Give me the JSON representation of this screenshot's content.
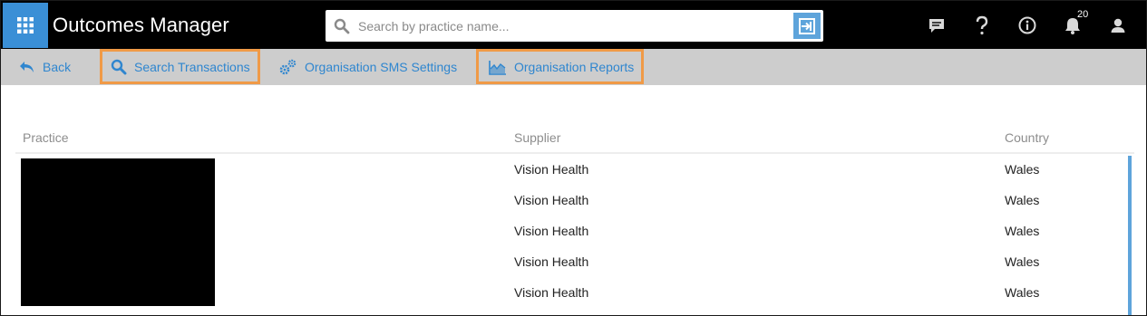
{
  "app": {
    "title": "Outcomes Manager"
  },
  "search": {
    "placeholder": "Search by practice name..."
  },
  "topbar": {
    "icons": [
      "menu-grid-icon",
      "chat-icon",
      "help-icon",
      "info-icon",
      "bell-icon",
      "user-icon"
    ],
    "notification_count": "20"
  },
  "subnav": {
    "back": "Back",
    "search_transactions": "Search Transactions",
    "sms_settings": "Organisation SMS Settings",
    "reports": "Organisation Reports"
  },
  "table": {
    "columns": [
      "Practice",
      "Supplier",
      "Country"
    ],
    "rows": [
      {
        "practice": "",
        "supplier": "Vision Health",
        "country": "Wales"
      },
      {
        "practice": "",
        "supplier": "Vision Health",
        "country": "Wales"
      },
      {
        "practice": "",
        "supplier": "Vision Health",
        "country": "Wales"
      },
      {
        "practice": "",
        "supplier": "Vision Health",
        "country": "Wales"
      },
      {
        "practice": "",
        "supplier": "Vision Health",
        "country": "Wales"
      }
    ]
  },
  "colors": {
    "topbar": "#000000",
    "accent": "#3a8fd6",
    "link": "#2f86cf",
    "highlight": "#f09a47",
    "subnav": "#cdcdcd"
  }
}
